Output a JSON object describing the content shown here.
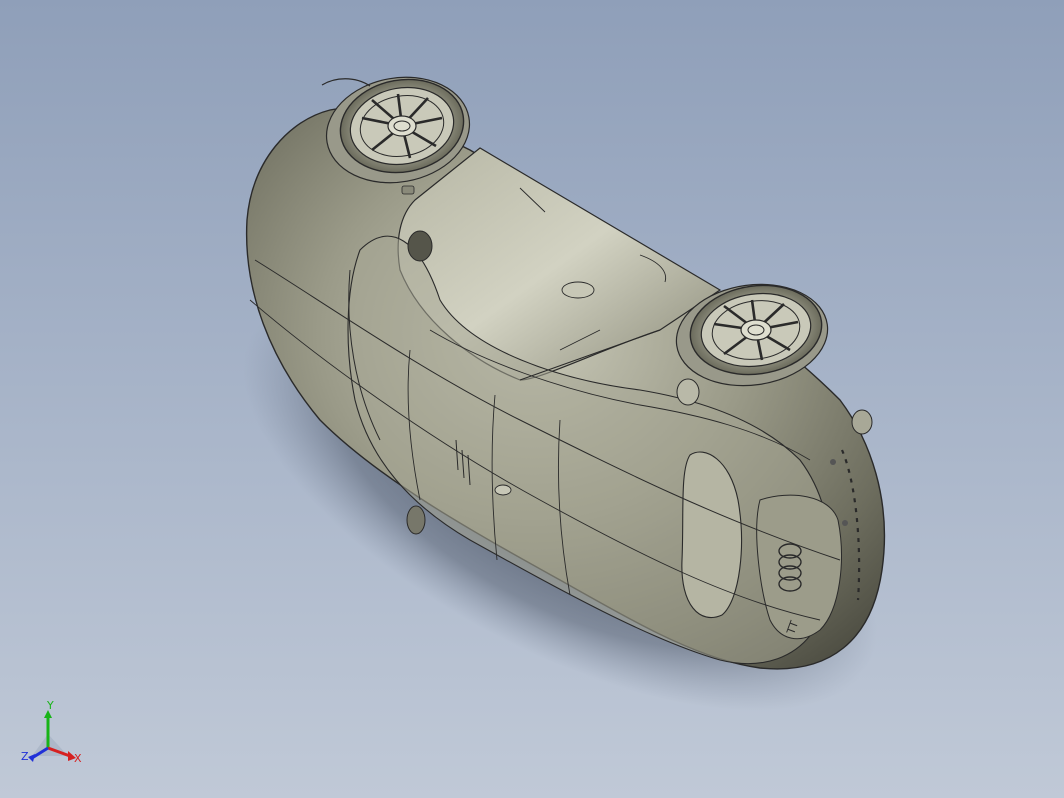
{
  "viewport": {
    "background_top": "#8f9fb9",
    "background_bottom": "#c0c9d7"
  },
  "model": {
    "body_color": "#8e8e7c",
    "edge_color": "#2a2a2a",
    "shadow_color": "#4b5566",
    "logo_rings": 4,
    "badge_text": "TT"
  },
  "triad": {
    "x_label": "X",
    "y_label": "Y",
    "z_label": "Z",
    "x_color": "#d62020",
    "y_color": "#18b418",
    "z_color": "#2030d8"
  }
}
